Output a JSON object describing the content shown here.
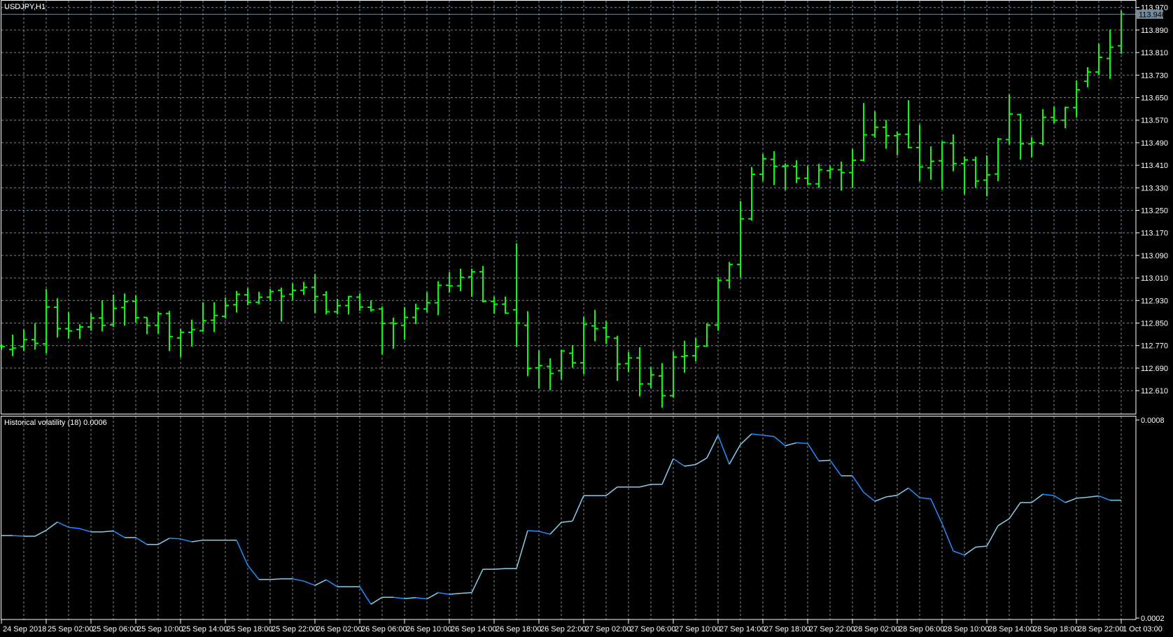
{
  "chart": {
    "symbol_label": "USDJPY,H1",
    "current_price": "113.946",
    "indicator_label": "Historical volatility (18) 0.0006",
    "colors": {
      "background": "#000000",
      "grid": "#778899",
      "bars": "#00FF00",
      "hv_up": "#87CEEB",
      "hv_down": "#1E90FF",
      "frame": "#FFFFFF",
      "price_tag": "#778899"
    }
  },
  "chart_data": {
    "type": "line",
    "title": "USDJPY,H1",
    "price_axis": {
      "ylim": [
        112.57,
        113.995
      ],
      "ticks": [
        "113.970",
        "113.890",
        "113.810",
        "113.730",
        "113.650",
        "113.570",
        "113.490",
        "113.410",
        "113.330",
        "113.250",
        "113.170",
        "113.090",
        "113.010",
        "112.930",
        "112.850",
        "112.770",
        "112.690",
        "112.610"
      ]
    },
    "indicator_axis": {
      "ylim": [
        0.0002,
        0.0008
      ],
      "ticks": [
        "0.0008",
        "0.0002"
      ]
    },
    "time_labels": [
      "24 Sep 2018",
      "25 Sep 02:00",
      "25 Sep 06:00",
      "25 Sep 10:00",
      "25 Sep 14:00",
      "25 Sep 18:00",
      "25 Sep 22:00",
      "26 Sep 02:00",
      "26 Sep 06:00",
      "26 Sep 10:00",
      "26 Sep 14:00",
      "26 Sep 18:00",
      "26 Sep 22:00",
      "27 Sep 02:00",
      "27 Sep 06:00",
      "27 Sep 10:00",
      "27 Sep 14:00",
      "27 Sep 18:00",
      "27 Sep 22:00",
      "28 Sep 02:00",
      "28 Sep 06:00",
      "28 Sep 10:00",
      "28 Sep 14:00",
      "28 Sep 18:00",
      "28 Sep 22:00",
      "1 Oct 03:00"
    ],
    "ohlc": [
      [
        112.768,
        112.775,
        112.758,
        112.766
      ],
      [
        112.756,
        112.809,
        112.735,
        112.761
      ],
      [
        112.766,
        112.827,
        112.753,
        112.791
      ],
      [
        112.791,
        112.849,
        112.758,
        112.778
      ],
      [
        112.776,
        112.971,
        112.745,
        112.907
      ],
      [
        112.906,
        112.938,
        112.801,
        112.83
      ],
      [
        112.83,
        112.889,
        112.797,
        112.822
      ],
      [
        112.827,
        112.846,
        112.796,
        112.836
      ],
      [
        112.836,
        112.884,
        112.825,
        112.868
      ],
      [
        112.868,
        112.931,
        112.823,
        112.842
      ],
      [
        112.844,
        112.951,
        112.838,
        112.902
      ],
      [
        112.905,
        112.955,
        112.843,
        112.926
      ],
      [
        112.927,
        112.949,
        112.853,
        112.869
      ],
      [
        112.87,
        112.871,
        112.813,
        112.842
      ],
      [
        112.842,
        112.891,
        112.815,
        112.883
      ],
      [
        112.884,
        112.893,
        112.753,
        112.802
      ],
      [
        112.797,
        112.83,
        112.731,
        112.817
      ],
      [
        112.817,
        112.862,
        112.769,
        112.827
      ],
      [
        112.823,
        112.924,
        112.821,
        112.858
      ],
      [
        112.86,
        112.924,
        112.82,
        112.877
      ],
      [
        112.874,
        112.941,
        112.869,
        112.912
      ],
      [
        112.915,
        112.964,
        112.89,
        112.952
      ],
      [
        112.95,
        112.974,
        112.915,
        112.924
      ],
      [
        112.924,
        112.961,
        112.919,
        112.942
      ],
      [
        112.942,
        112.971,
        112.93,
        112.962
      ],
      [
        112.966,
        112.976,
        112.858,
        112.945
      ],
      [
        112.952,
        112.991,
        112.933,
        112.966
      ],
      [
        112.966,
        112.996,
        112.952,
        112.977
      ],
      [
        112.977,
        113.024,
        112.888,
        112.944
      ],
      [
        112.95,
        112.963,
        112.883,
        112.89
      ],
      [
        112.89,
        112.936,
        112.883,
        112.912
      ],
      [
        112.912,
        112.946,
        112.883,
        112.944
      ],
      [
        112.942,
        112.956,
        112.896,
        112.907
      ],
      [
        112.906,
        112.931,
        112.893,
        112.897
      ],
      [
        112.9,
        112.909,
        112.741,
        112.849
      ],
      [
        112.85,
        112.869,
        112.761,
        112.848
      ],
      [
        112.842,
        112.907,
        112.793,
        112.87
      ],
      [
        112.87,
        112.918,
        112.849,
        112.902
      ],
      [
        112.9,
        112.959,
        112.89,
        112.922
      ],
      [
        112.922,
        112.998,
        112.88,
        112.984
      ],
      [
        112.984,
        113.031,
        112.96,
        112.982
      ],
      [
        112.982,
        113.043,
        112.965,
        113.012
      ],
      [
        113.014,
        113.043,
        112.946,
        113.032
      ],
      [
        113.032,
        113.053,
        112.926,
        112.927
      ],
      [
        112.927,
        112.944,
        112.885,
        112.917
      ],
      [
        112.917,
        112.944,
        112.885,
        112.885
      ],
      [
        112.897,
        113.133,
        112.768,
        112.85
      ],
      [
        112.842,
        112.892,
        112.664,
        112.689
      ],
      [
        112.691,
        112.753,
        112.621,
        112.699
      ],
      [
        112.696,
        112.725,
        112.614,
        112.671
      ],
      [
        112.681,
        112.755,
        112.652,
        112.751
      ],
      [
        112.743,
        112.772,
        112.694,
        112.709
      ],
      [
        112.709,
        112.872,
        112.671,
        112.845
      ],
      [
        112.84,
        112.897,
        112.788,
        112.83
      ],
      [
        112.833,
        112.857,
        112.778,
        112.801
      ],
      [
        112.796,
        112.805,
        112.647,
        112.704
      ],
      [
        112.706,
        112.748,
        112.678,
        112.726
      ],
      [
        112.726,
        112.764,
        112.592,
        112.634
      ],
      [
        112.634,
        112.694,
        112.621,
        112.666
      ],
      [
        112.662,
        112.708,
        112.552,
        112.592
      ],
      [
        112.592,
        112.749,
        112.587,
        112.729
      ],
      [
        112.731,
        112.787,
        112.676,
        112.734
      ],
      [
        112.734,
        112.797,
        112.716,
        112.766
      ],
      [
        112.768,
        112.849,
        112.768,
        112.843
      ],
      [
        112.843,
        113.013,
        112.825,
        113.002
      ],
      [
        113.002,
        113.067,
        112.975,
        113.058
      ],
      [
        113.058,
        113.283,
        113.014,
        113.22
      ],
      [
        113.22,
        113.404,
        113.216,
        113.378
      ],
      [
        113.378,
        113.45,
        113.356,
        113.433
      ],
      [
        113.431,
        113.46,
        113.342,
        113.406
      ],
      [
        113.406,
        113.417,
        113.324,
        113.408
      ],
      [
        113.406,
        113.428,
        113.349,
        113.364
      ],
      [
        113.364,
        113.408,
        113.342,
        113.344
      ],
      [
        113.344,
        113.415,
        113.332,
        113.394
      ],
      [
        113.391,
        113.408,
        113.366,
        113.396
      ],
      [
        113.394,
        113.423,
        113.322,
        113.384
      ],
      [
        113.384,
        113.468,
        113.332,
        113.428
      ],
      [
        113.428,
        113.631,
        113.426,
        113.518
      ],
      [
        113.518,
        113.602,
        113.51,
        113.545
      ],
      [
        113.545,
        113.571,
        113.471,
        113.515
      ],
      [
        113.515,
        113.529,
        113.448,
        113.52
      ],
      [
        113.52,
        113.641,
        113.472,
        113.473
      ],
      [
        113.473,
        113.554,
        113.356,
        113.404
      ],
      [
        113.401,
        113.477,
        113.361,
        113.424
      ],
      [
        113.426,
        113.495,
        113.327,
        113.491
      ],
      [
        113.488,
        113.52,
        113.391,
        113.416
      ],
      [
        113.416,
        113.441,
        113.309,
        113.429
      ],
      [
        113.429,
        113.441,
        113.332,
        113.354
      ],
      [
        113.357,
        113.445,
        113.302,
        113.376
      ],
      [
        113.379,
        113.507,
        113.356,
        113.503
      ],
      [
        113.501,
        113.661,
        113.486,
        113.592
      ],
      [
        113.59,
        113.593,
        113.432,
        113.486
      ],
      [
        113.486,
        113.509,
        113.441,
        113.491
      ],
      [
        113.488,
        113.609,
        113.483,
        113.58
      ],
      [
        113.58,
        113.618,
        113.561,
        113.57
      ],
      [
        113.57,
        113.618,
        113.544,
        113.615
      ],
      [
        113.615,
        113.711,
        113.582,
        113.678
      ],
      [
        113.708,
        113.758,
        113.689,
        113.741
      ],
      [
        113.741,
        113.842,
        113.733,
        113.793
      ],
      [
        113.789,
        113.892,
        113.719,
        113.829
      ],
      [
        113.834,
        113.959,
        113.808,
        113.946
      ]
    ],
    "hv_values": [
      0.00045,
      0.00045,
      0.000448,
      0.000448,
      0.000466,
      0.000491,
      0.000475,
      0.000471,
      0.000461,
      0.000461,
      0.000464,
      0.000444,
      0.000444,
      0.000423,
      0.000423,
      0.000442,
      0.00044,
      0.000431,
      0.000436,
      0.000436,
      0.000436,
      0.000436,
      0.00036,
      0.000317,
      0.000317,
      0.000319,
      0.000319,
      0.000312,
      0.000299,
      0.000316,
      0.000295,
      0.000295,
      0.000295,
      0.000242,
      0.000263,
      0.000263,
      0.000259,
      0.000262,
      0.000258,
      0.000277,
      0.000272,
      0.000275,
      0.000277,
      0.000348,
      0.000348,
      0.00035,
      0.00035,
      0.000465,
      0.000463,
      0.000454,
      0.00049,
      0.000494,
      0.000571,
      0.000571,
      0.000571,
      0.000597,
      0.000597,
      0.000597,
      0.000605,
      0.000605,
      0.000683,
      0.00066,
      0.000665,
      0.000685,
      0.000754,
      0.000666,
      0.000726,
      0.000758,
      0.000754,
      0.00075,
      0.000722,
      0.000731,
      0.000729,
      0.000676,
      0.000678,
      0.000631,
      0.000631,
      0.000581,
      0.000554,
      0.000567,
      0.000572,
      0.000594,
      0.000565,
      0.000561,
      0.000487,
      0.000403,
      0.000391,
      0.000415,
      0.000418,
      0.00048,
      0.000501,
      0.00055,
      0.00055,
      0.000575,
      0.000571,
      0.00055,
      0.000563,
      0.000566,
      0.00057,
      0.000557,
      0.000557
    ]
  }
}
